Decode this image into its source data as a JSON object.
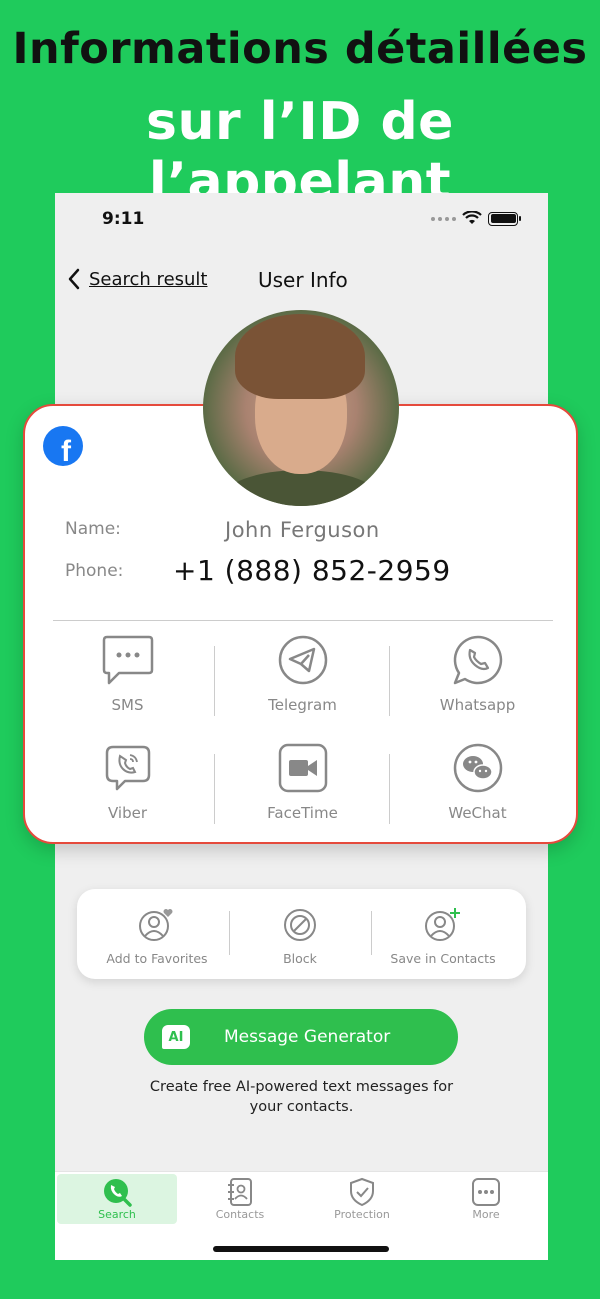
{
  "promo": {
    "line1": "Informations détaillées",
    "line2": "sur l’ID de l’appelant"
  },
  "status_bar": {
    "time": "9:11"
  },
  "nav": {
    "back_label": "Search result",
    "title": "User Info"
  },
  "contact": {
    "source_icon": "facebook-icon",
    "name_label": "Name:",
    "name": "John Ferguson",
    "phone_label": "Phone:",
    "phone": "+1 (888) 852-2959"
  },
  "apps": [
    {
      "label": "SMS",
      "icon": "sms-icon"
    },
    {
      "label": "Telegram",
      "icon": "telegram-icon"
    },
    {
      "label": "Whatsapp",
      "icon": "whatsapp-icon"
    },
    {
      "label": "Viber",
      "icon": "viber-icon"
    },
    {
      "label": "FaceTime",
      "icon": "facetime-icon"
    },
    {
      "label": "WeChat",
      "icon": "wechat-icon"
    }
  ],
  "actions": [
    {
      "label": "Add to Favorites",
      "icon": "favorite-user-icon"
    },
    {
      "label": "Block",
      "icon": "block-icon"
    },
    {
      "label": "Save in Contacts",
      "icon": "add-contact-icon"
    }
  ],
  "ai": {
    "badge": "AI",
    "button_label": "Message Generator",
    "description": "Create free AI-powered text messages for your contacts."
  },
  "tabs": [
    {
      "label": "Search",
      "icon": "phone-search-icon",
      "active": true
    },
    {
      "label": "Contacts",
      "icon": "contacts-icon",
      "active": false
    },
    {
      "label": "Protection",
      "icon": "shield-icon",
      "active": false
    },
    {
      "label": "More",
      "icon": "more-icon",
      "active": false
    }
  ],
  "colors": {
    "brand_green": "#1fcb5c",
    "button_green": "#2fbf4e",
    "card_border": "#e54a3c",
    "facebook_blue": "#1877f2"
  }
}
